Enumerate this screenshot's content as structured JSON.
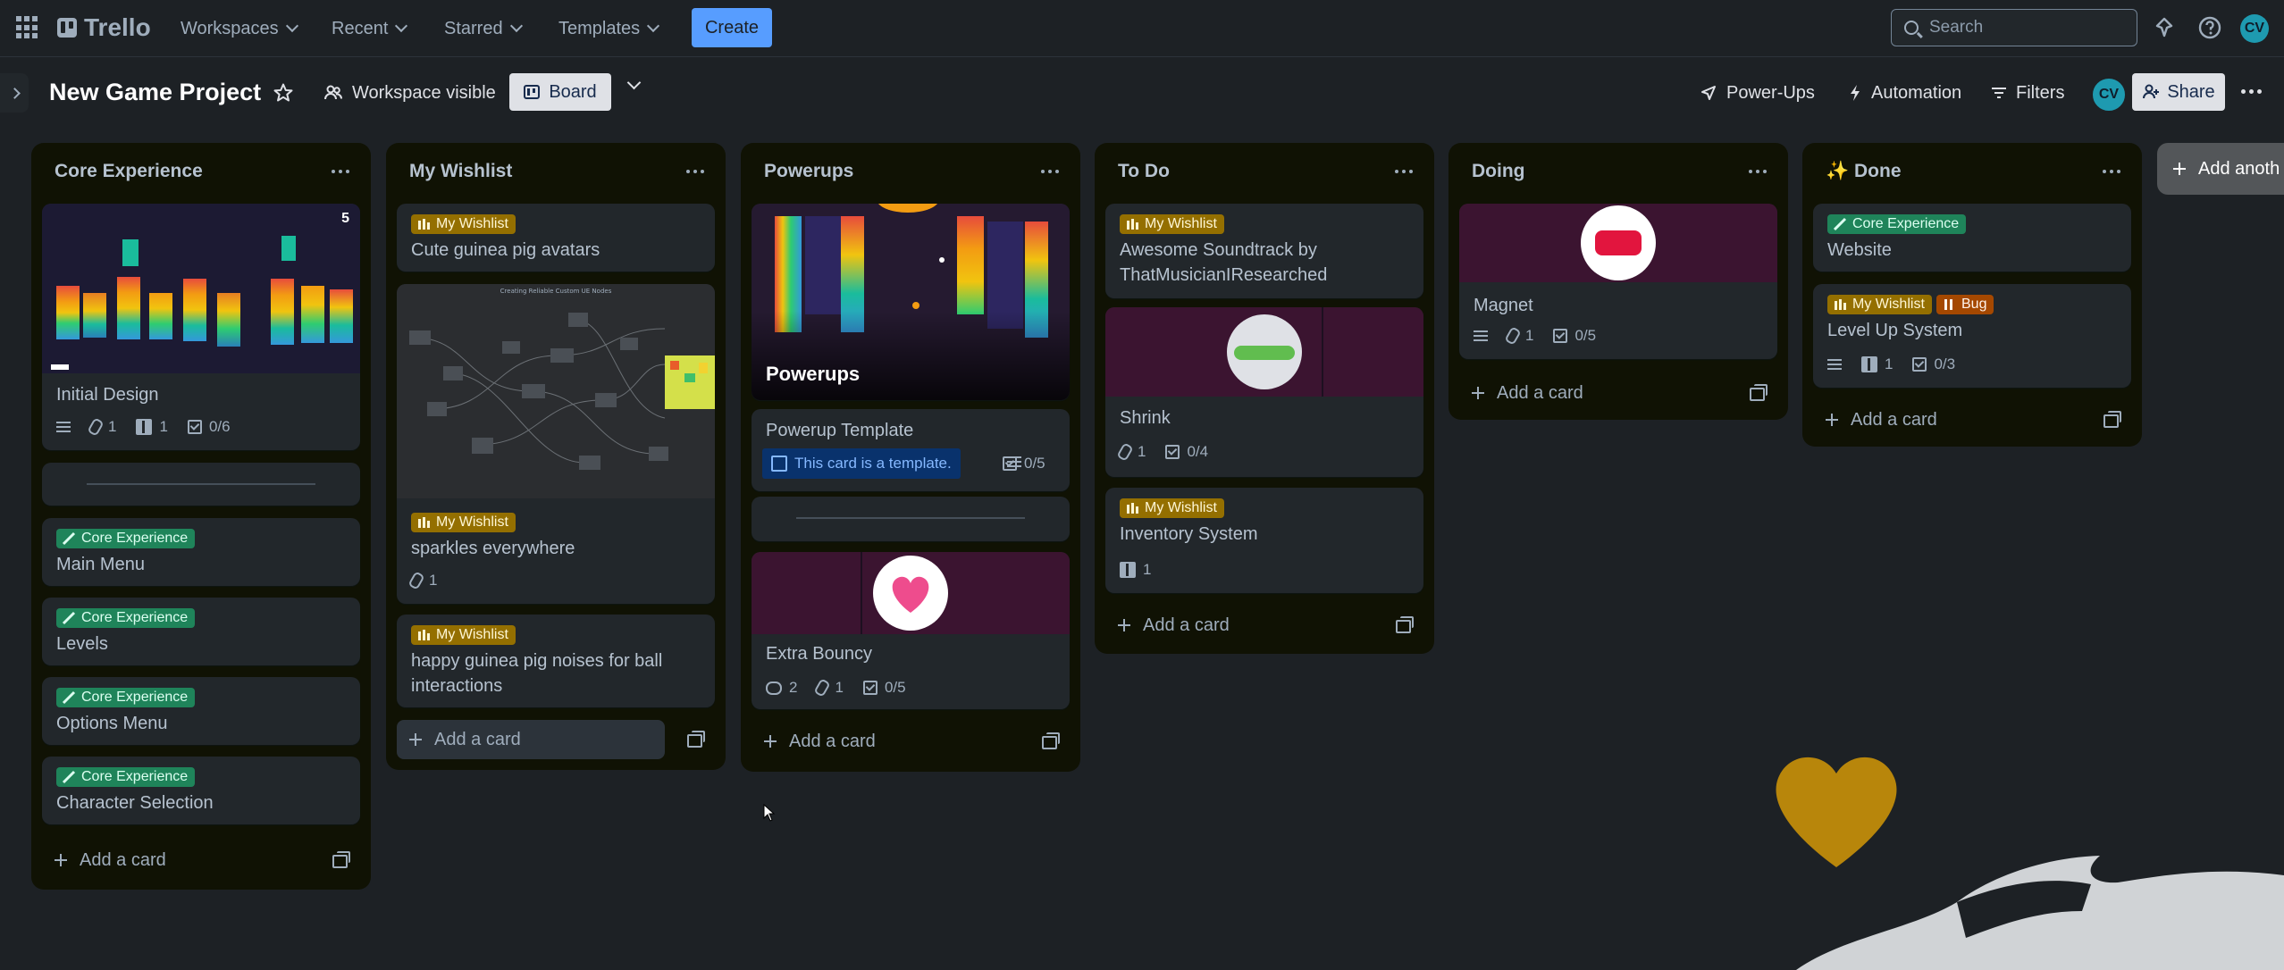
{
  "nav": {
    "logo": "Trello",
    "workspaces": "Workspaces",
    "recent": "Recent",
    "starred": "Starred",
    "templates": "Templates",
    "create": "Create",
    "search_placeholder": "Search",
    "avatar_initials": "CV"
  },
  "board": {
    "title": "New Game Project",
    "visibility": "Workspace visible",
    "view": "Board",
    "powerups": "Power-Ups",
    "automation": "Automation",
    "filters": "Filters",
    "share": "Share",
    "member_initials": "CV",
    "add_another": "Add anoth"
  },
  "lists": [
    {
      "title": "Core Experience",
      "add": "Add a card",
      "cards": [
        {
          "title": "Initial Design",
          "attachments": "1",
          "boards": "1",
          "checklist": "0/6",
          "cover_badge": "5"
        },
        {
          "title": "Main Menu",
          "label": "Core Experience"
        },
        {
          "title": "Levels",
          "label": "Core Experience"
        },
        {
          "title": "Options Menu",
          "label": "Core Experience"
        },
        {
          "title": "Character Selection",
          "label": "Core Experience"
        }
      ]
    },
    {
      "title": "My Wishlist",
      "add": "Add a card",
      "cards": [
        {
          "title": "Cute guinea pig avatars",
          "label": "My Wishlist"
        },
        {
          "title": "sparkles everywhere",
          "label": "My Wishlist",
          "attachments": "1"
        },
        {
          "title": "happy guinea pig noises for ball interactions",
          "label": "My Wishlist"
        }
      ]
    },
    {
      "title": "Powerups",
      "add": "Add a card",
      "cards": [
        {
          "title": "Powerups"
        },
        {
          "title": "Powerup Template",
          "template_badge": "This card is a template.",
          "checklist": "0/5"
        },
        {
          "title": "Extra Bouncy",
          "comments": "2",
          "attachments": "1",
          "checklist": "0/5"
        }
      ]
    },
    {
      "title": "To Do",
      "add": "Add a card",
      "cards": [
        {
          "title": "Awesome Soundtrack by ThatMusicianIResearched",
          "label": "My Wishlist"
        },
        {
          "title": "Shrink",
          "attachments": "1",
          "checklist": "0/4"
        },
        {
          "title": "Inventory System",
          "label": "My Wishlist",
          "boards": "1"
        }
      ]
    },
    {
      "title": "Doing",
      "add": "Add a card",
      "cards": [
        {
          "title": "Magnet",
          "attachments": "1",
          "checklist": "0/5"
        }
      ]
    },
    {
      "title": "Done",
      "title_emoji": "✨",
      "add": "Add a card",
      "cards": [
        {
          "title": "Website",
          "label": "Core Experience"
        },
        {
          "title": "Level Up System",
          "label": "My Wishlist",
          "label2": "Bug",
          "boards": "1",
          "checklist": "0/3"
        }
      ]
    }
  ]
}
